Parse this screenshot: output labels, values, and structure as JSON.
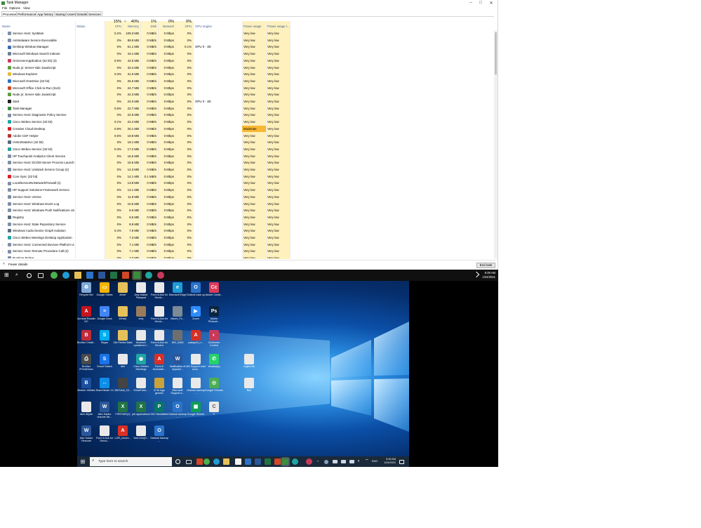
{
  "window": {
    "title": "Task Manager",
    "controls": [
      "–",
      "□",
      "✕"
    ]
  },
  "menu": [
    "File",
    "Options",
    "View"
  ],
  "tabs": [
    "Processes",
    "Performance",
    "App history",
    "Startup",
    "Users",
    "Details",
    "Services"
  ],
  "header": {
    "name": "Name",
    "status": "Status",
    "cpu_pct": "15%",
    "cpu": "CPU",
    "mem_pct": "40%",
    "mem": "Memory",
    "disk_pct": "1%",
    "disk": "Disk",
    "net_pct": "0%",
    "net": "Network",
    "gpu_pct": "0%",
    "gpu": "GPU",
    "gpu_engine": "GPU engine",
    "power": "Power usage",
    "power_trend": "Power usage t...",
    "sort_arrow": "˅"
  },
  "processes": [
    {
      "name": "Service Host: SysMain",
      "cpu": "0.2%",
      "mem": "109.3 MB",
      "disk": "0 MB/s",
      "net": "0 Mbps",
      "gpu": "0%",
      "engine": "",
      "power": "Very low",
      "trend": "Very low",
      "icon": "gear-icon",
      "color": "#7f8fa6",
      "exp": true
    },
    {
      "name": "Antimalware Service Executable",
      "cpu": "0%",
      "mem": "89.8 MB",
      "disk": "0 MB/s",
      "net": "0 Mbps",
      "gpu": "0%",
      "engine": "",
      "power": "Very low",
      "trend": "Very low",
      "icon": "gear-icon",
      "color": "#7f8fa6",
      "exp": true
    },
    {
      "name": "Desktop Window Manager",
      "cpu": "0%",
      "mem": "61.1 MB",
      "disk": "0 MB/s",
      "net": "0 Mbps",
      "gpu": "0.1%",
      "engine": "GPU 0 - 3D",
      "power": "Very low",
      "trend": "Very low",
      "icon": "window-icon",
      "color": "#3b6fb6",
      "exp": false
    },
    {
      "name": "Microsoft Windows Search Indexer",
      "cpu": "0%",
      "mem": "43.1 MB",
      "disk": "0 MB/s",
      "net": "0 Mbps",
      "gpu": "0%",
      "engine": "",
      "power": "Very low",
      "trend": "Very low",
      "icon": "search-icon",
      "color": "#6d7f95",
      "exp": true
    },
    {
      "name": "OnScreenApplication (32 bit) (3)",
      "cpu": "0.9%",
      "mem": "42.5 MB",
      "disk": "0 MB/s",
      "net": "0 Mbps",
      "gpu": "0%",
      "engine": "",
      "power": "Very low",
      "trend": "Very low",
      "icon": "onscreen-icon",
      "color": "#c93a5a",
      "exp": true
    },
    {
      "name": "Node.js: Server-side JavaScript",
      "cpu": "0%",
      "mem": "33.4 MB",
      "disk": "0 MB/s",
      "net": "0 Mbps",
      "gpu": "0%",
      "engine": "",
      "power": "Very low",
      "trend": "Very low",
      "icon": "nodejs-icon",
      "color": "#5f9e3a",
      "exp": false
    },
    {
      "name": "Windows Explorer",
      "cpu": "0.3%",
      "mem": "31.5 MB",
      "disk": "0 MB/s",
      "net": "0 Mbps",
      "gpu": "0%",
      "engine": "",
      "power": "Very low",
      "trend": "Very low",
      "icon": "folder-icon",
      "color": "#e6b93c",
      "exp": false
    },
    {
      "name": "Microsoft OneDrive (32 bit)",
      "cpu": "0%",
      "mem": "26.6 MB",
      "disk": "0 MB/s",
      "net": "0 Mbps",
      "gpu": "0%",
      "engine": "",
      "power": "Very low",
      "trend": "Very low",
      "icon": "cloud-icon",
      "color": "#2a73c9",
      "exp": false
    },
    {
      "name": "Microsoft Office Click-to-Run (SxS)",
      "cpu": "0%",
      "mem": "24.7 MB",
      "disk": "0 MB/s",
      "net": "0 Mbps",
      "gpu": "0%",
      "engine": "",
      "power": "Very low",
      "trend": "Very low",
      "icon": "office-icon",
      "color": "#d24726",
      "exp": true
    },
    {
      "name": "Node.js: Server-side JavaScript",
      "cpu": "0%",
      "mem": "24.3 MB",
      "disk": "0 MB/s",
      "net": "0 Mbps",
      "gpu": "0%",
      "engine": "",
      "power": "Very low",
      "trend": "Very low",
      "icon": "nodejs-icon",
      "color": "#5f9e3a",
      "exp": false
    },
    {
      "name": "Start",
      "cpu": "0%",
      "mem": "24.0 MB",
      "disk": "0 MB/s",
      "net": "0 Mbps",
      "gpu": "0%",
      "engine": "GPU 0 - 3D",
      "power": "Very low",
      "trend": "Very low",
      "icon": "start-icon",
      "color": "#222222",
      "exp": true
    },
    {
      "name": "Task Manager",
      "cpu": "0.6%",
      "mem": "22.7 MB",
      "disk": "0 MB/s",
      "net": "0 Mbps",
      "gpu": "0%",
      "engine": "",
      "power": "Very low",
      "trend": "Very low",
      "icon": "task-manager-icon",
      "color": "#3a8d3a",
      "exp": true
    },
    {
      "name": "Service Host: Diagnostic Policy Service",
      "cpu": "0%",
      "mem": "22.5 MB",
      "disk": "0 MB/s",
      "net": "0 Mbps",
      "gpu": "0%",
      "engine": "",
      "power": "Very low",
      "trend": "Very low",
      "icon": "gear-icon",
      "color": "#7f8fa6",
      "exp": true
    },
    {
      "name": "Cisco Webex Service (32 bit)",
      "cpu": "0.1%",
      "mem": "22.4 MB",
      "disk": "0 MB/s",
      "net": "0 Mbps",
      "gpu": "0%",
      "engine": "",
      "power": "Very low",
      "trend": "Very low",
      "icon": "webex-icon",
      "color": "#21a5a0",
      "exp": true
    },
    {
      "name": "Creative Cloud Desktop",
      "cpu": "0.8%",
      "mem": "20.1 MB",
      "disk": "0 MB/s",
      "net": "0 Mbps",
      "gpu": "0%",
      "engine": "",
      "power": "Moderate",
      "trend": "Very low",
      "icon": "creative-cloud-icon",
      "color": "#da1f26",
      "exp": true
    },
    {
      "name": "Adobe CEF Helper",
      "cpu": "0.6%",
      "mem": "19.8 MB",
      "disk": "0 MB/s",
      "net": "0 Mbps",
      "gpu": "0%",
      "engine": "",
      "power": "Very low",
      "trend": "Very low",
      "icon": "adobe-icon",
      "color": "#b8322e",
      "exp": false
    },
    {
      "name": "IAStorDataSvc (32 bit)",
      "cpu": "0%",
      "mem": "19.1 MB",
      "disk": "0 MB/s",
      "net": "0 Mbps",
      "gpu": "0%",
      "engine": "",
      "power": "Very low",
      "trend": "Very low",
      "icon": "storage-icon",
      "color": "#5a6b80",
      "exp": true
    },
    {
      "name": "Cisco Webex Service (32 bit)",
      "cpu": "0.3%",
      "mem": "17.2 MB",
      "disk": "0 MB/s",
      "net": "0 Mbps",
      "gpu": "0%",
      "engine": "",
      "power": "Very low",
      "trend": "Very low",
      "icon": "webex-icon",
      "color": "#21a5a0",
      "exp": true
    },
    {
      "name": "HP Touchpoint Analytics Client Service",
      "cpu": "0%",
      "mem": "16.6 MB",
      "disk": "0 MB/s",
      "net": "0 Mbps",
      "gpu": "0%",
      "engine": "",
      "power": "Very low",
      "trend": "Very low",
      "icon": "gear-icon",
      "color": "#7f8fa6",
      "exp": true
    },
    {
      "name": "Service Host: DCOM Server Process Launcher (5)",
      "cpu": "0%",
      "mem": "15.6 MB",
      "disk": "0 MB/s",
      "net": "0 Mbps",
      "gpu": "0%",
      "engine": "",
      "power": "Very low",
      "trend": "Very low",
      "icon": "gear-icon",
      "color": "#7f8fa6",
      "exp": true
    },
    {
      "name": "Service Host: Unistack Service Group (4)",
      "cpu": "0%",
      "mem": "14.3 MB",
      "disk": "0 MB/s",
      "net": "0 Mbps",
      "gpu": "0%",
      "engine": "",
      "power": "Very low",
      "trend": "Very low",
      "icon": "gear-icon",
      "color": "#7f8fa6",
      "exp": true
    },
    {
      "name": "Core Sync (32 bit)",
      "cpu": "0%",
      "mem": "14.1 MB",
      "disk": "0.1 MB/s",
      "net": "0 Mbps",
      "gpu": "0%",
      "engine": "",
      "power": "Very low",
      "trend": "Very low",
      "icon": "sync-icon",
      "color": "#da1f26",
      "exp": false
    },
    {
      "name": "LocalServiceNoNetworkFirewall (2)",
      "cpu": "0%",
      "mem": "13.8 MB",
      "disk": "0 MB/s",
      "net": "0 Mbps",
      "gpu": "0%",
      "engine": "",
      "power": "Very low",
      "trend": "Very low",
      "icon": "gear-icon",
      "color": "#7f8fa6",
      "exp": true
    },
    {
      "name": "HP Support Solutions Framework Service",
      "cpu": "0%",
      "mem": "13.1 MB",
      "disk": "0 MB/s",
      "net": "0 Mbps",
      "gpu": "0%",
      "engine": "",
      "power": "Very low",
      "trend": "Very low",
      "icon": "gear-icon",
      "color": "#7f8fa6",
      "exp": true
    },
    {
      "name": "Service Host: UtcSvc",
      "cpu": "0%",
      "mem": "11.9 MB",
      "disk": "0 MB/s",
      "net": "0 Mbps",
      "gpu": "0%",
      "engine": "",
      "power": "Very low",
      "trend": "Very low",
      "icon": "gear-icon",
      "color": "#7f8fa6",
      "exp": true
    },
    {
      "name": "Service Host: Windows Event Log",
      "cpu": "0%",
      "mem": "10.6 MB",
      "disk": "0 MB/s",
      "net": "0 Mbps",
      "gpu": "0%",
      "engine": "",
      "power": "Very low",
      "trend": "Very low",
      "icon": "gear-icon",
      "color": "#7f8fa6",
      "exp": true
    },
    {
      "name": "Service Host: Windows Push Notifications Use...",
      "cpu": "0%",
      "mem": "9.6 MB",
      "disk": "0 MB/s",
      "net": "0 Mbps",
      "gpu": "0%",
      "engine": "",
      "power": "Very low",
      "trend": "Very low",
      "icon": "gear-icon",
      "color": "#7f8fa6",
      "exp": true
    },
    {
      "name": "Registry",
      "cpu": "0%",
      "mem": "9.5 MB",
      "disk": "0 MB/s",
      "net": "0 Mbps",
      "gpu": "0%",
      "engine": "",
      "power": "Very low",
      "trend": "Very low",
      "icon": "registry-icon",
      "color": "#5a6b80",
      "exp": false
    },
    {
      "name": "Service Host: State Repository Service",
      "cpu": "0%",
      "mem": "8.8 MB",
      "disk": "0 MB/s",
      "net": "0 Mbps",
      "gpu": "0%",
      "engine": "",
      "power": "Very low",
      "trend": "Very low",
      "icon": "gear-icon",
      "color": "#7f8fa6",
      "exp": true
    },
    {
      "name": "Windows Audio Device Graph Isolation",
      "cpu": "0.4%",
      "mem": "7.9 MB",
      "disk": "0 MB/s",
      "net": "0 Mbps",
      "gpu": "0%",
      "engine": "",
      "power": "Very low",
      "trend": "Very low",
      "icon": "audio-icon",
      "color": "#5a6b80",
      "exp": false
    },
    {
      "name": "Cisco Webex Meetings Desktop Application",
      "cpu": "0%",
      "mem": "7.3 MB",
      "disk": "0 MB/s",
      "net": "0 Mbps",
      "gpu": "0%",
      "engine": "",
      "power": "Very low",
      "trend": "Very low",
      "icon": "webex-icon",
      "color": "#21a5a0",
      "exp": false
    },
    {
      "name": "Service Host: Connected Devices Platform Use...",
      "cpu": "0%",
      "mem": "7.1 MB",
      "disk": "0 MB/s",
      "net": "0 Mbps",
      "gpu": "0%",
      "engine": "",
      "power": "Very low",
      "trend": "Very low",
      "icon": "gear-icon",
      "color": "#7f8fa6",
      "exp": true
    },
    {
      "name": "Service Host: Remote Procedure Call (2)",
      "cpu": "0%",
      "mem": "7.1 MB",
      "disk": "0 MB/s",
      "net": "0 Mbps",
      "gpu": "0%",
      "engine": "",
      "power": "Very low",
      "trend": "Very low",
      "icon": "gear-icon",
      "color": "#7f8fa6",
      "exp": true
    },
    {
      "name": "Runtime Broker",
      "cpu": "0%",
      "mem": "7.0 MB",
      "disk": "0 MB/s",
      "net": "0 Mbps",
      "gpu": "0%",
      "engine": "",
      "power": "Very low",
      "trend": "Very low",
      "icon": "gear-icon",
      "color": "#7f8fa6",
      "exp": false
    }
  ],
  "footer": {
    "fewer_details": "Fewer details",
    "end_task": "End task"
  },
  "taskbar_outer": {
    "time": "9:39 AM",
    "date": "1/24/2021"
  },
  "desktop_icons": [
    {
      "label": "Recycle Bin",
      "icon": "recycle-bin-icon",
      "color": "#7fa9d6",
      "glyph": "♻"
    },
    {
      "label": "Google Slides",
      "icon": "google-slides-icon",
      "color": "#f4b400",
      "glyph": "▭"
    },
    {
      "label": "driver",
      "icon": "folder-icon",
      "color": "#e6c15a",
      "glyph": ""
    },
    {
      "label": "Amy Kaidor Passport",
      "icon": "document-icon",
      "color": "#e9e9e9",
      "glyph": ""
    },
    {
      "label": "Form 6 Ack for Servic...",
      "icon": "document-icon",
      "color": "#e9e9e9",
      "glyph": ""
    },
    {
      "label": "Microsoft Edge",
      "icon": "edge-icon",
      "color": "#1f9bd6",
      "glyph": "e"
    },
    {
      "label": "Outlook back up",
      "icon": "outlook-icon",
      "color": "#2a73c9",
      "glyph": "O"
    },
    {
      "label": "Adobe Creati...",
      "icon": "creative-cloud-icon",
      "color": "#e03a5a",
      "glyph": "Cc"
    },
    {
      "label": "Acrobat Reader DC",
      "icon": "acrobat-icon",
      "color": "#c4161c",
      "glyph": "A"
    },
    {
      "label": "Google Docs",
      "icon": "google-docs-icon",
      "color": "#4285f4",
      "glyph": "≡"
    },
    {
      "label": "inthelp",
      "icon": "folder-icon",
      "color": "#e6c15a",
      "glyph": ""
    },
    {
      "label": "amy",
      "icon": "photo-icon",
      "color": "#9a7c5a",
      "glyph": ""
    },
    {
      "label": "Form 6 Ack for Servic...",
      "icon": "document-icon",
      "color": "#e9e9e9",
      "glyph": ""
    },
    {
      "label": "Machi_Pc...",
      "icon": "photo-icon",
      "color": "#7c8a96",
      "glyph": ""
    },
    {
      "label": "Zoom",
      "icon": "zoom-icon",
      "color": "#2d8cff",
      "glyph": "▶"
    },
    {
      "label": "Adobe Photosh...",
      "icon": "photoshop-icon",
      "color": "#0b2540",
      "glyph": "Ps"
    },
    {
      "label": "Brother Creati...",
      "icon": "brother-icon",
      "color": "#c22b3a",
      "glyph": "B"
    },
    {
      "label": "Skype",
      "icon": "skype-icon",
      "color": "#00aff0",
      "glyph": "S"
    },
    {
      "label": "Old Firefox Data",
      "icon": "folder-icon",
      "color": "#e6c15a",
      "glyph": ""
    },
    {
      "label": "biomech questions f...",
      "icon": "document-icon",
      "color": "#e9e9e9",
      "glyph": ""
    },
    {
      "label": "Form 6 Ack for Service",
      "icon": "document-icon",
      "color": "#e9e9e9",
      "glyph": ""
    },
    {
      "label": "IMV_0408",
      "icon": "photo-icon",
      "color": "#6f6f6f",
      "glyph": ""
    },
    {
      "label": "passport_n...",
      "icon": "pdf-icon",
      "color": "#d93025",
      "glyph": "A"
    },
    {
      "label": "OnScreen Control",
      "icon": "onscreen-icon",
      "color": "#c93a5a",
      "glyph": "◐"
    },
    {
      "label": "Brother iPrint&Scan",
      "icon": "printer-icon",
      "color": "#4a4a4a",
      "glyph": "⎙"
    },
    {
      "label": "Smart Switch",
      "icon": "smart-switch-icon",
      "color": "#1a73e8",
      "glyph": "S"
    },
    {
      "label": "dee",
      "icon": "document-icon",
      "color": "#e9e9e9",
      "glyph": ""
    },
    {
      "label": "Cisco Webex Meetings",
      "icon": "webex-icon",
      "color": "#21a5a0",
      "glyph": "◉"
    },
    {
      "label": "Form 6 Acknowle...",
      "icon": "pdf-icon",
      "color": "#d93025",
      "glyph": "A"
    },
    {
      "label": "Notification of Appoint...",
      "icon": "word-icon",
      "color": "#2b579a",
      "glyph": "W"
    },
    {
      "label": "MS Support chat conv...",
      "icon": "document-icon",
      "color": "#e9e9e9",
      "glyph": ""
    },
    {
      "label": "WhatsApp",
      "icon": "whatsapp-icon",
      "color": "#25d366",
      "glyph": "✆"
    },
    {
      "label": "Brother Utilities",
      "icon": "brother-icon",
      "color": "#1b4fa0",
      "glyph": "B"
    },
    {
      "label": "TeamViewer 14",
      "icon": "teamviewer-icon",
      "color": "#0e8ee9",
      "glyph": "↔"
    },
    {
      "label": "2667ddd_15...",
      "icon": "photo-icon",
      "color": "#444444",
      "glyph": ""
    },
    {
      "label": "EmailTicke...",
      "icon": "document-icon",
      "color": "#e9e9e9",
      "glyph": ""
    },
    {
      "label": "IO fb logo generic",
      "icon": "photo-icon",
      "color": "#c8a23a",
      "glyph": ""
    },
    {
      "label": "Microsoft Support a...",
      "icon": "document-icon",
      "color": "#e9e9e9",
      "glyph": ""
    },
    {
      "label": "Outlook backup ...",
      "icon": "document-icon",
      "color": "#e9e9e9",
      "glyph": ""
    },
    {
      "label": "Google Chrome",
      "icon": "chrome-icon",
      "color": "#4caf50",
      "glyph": "◎"
    },
    {
      "label": "Alex Aliyah",
      "icon": "document-icon",
      "color": "#e9e9e9",
      "glyph": ""
    },
    {
      "label": "Alex Kaidor resume Ne...",
      "icon": "word-icon",
      "color": "#2b579a",
      "glyph": "W"
    },
    {
      "label": "FIRSTAID(1)",
      "icon": "excel-icon",
      "color": "#217346",
      "glyph": "X"
    },
    {
      "label": "job applications",
      "icon": "excel-icon",
      "color": "#217346",
      "glyph": "X"
    },
    {
      "label": "TAC Newsletter",
      "icon": "publisher-icon",
      "color": "#077568",
      "glyph": "P"
    },
    {
      "label": "Outlook backup ...",
      "icon": "outlook-icon",
      "color": "#2a73c9",
      "glyph": "O"
    },
    {
      "label": "Google Sheets",
      "icon": "google-sheets-icon",
      "color": "#0f9d58",
      "glyph": "▦"
    },
    {
      "label": "C",
      "icon": "document-icon",
      "color": "#e9e9e9",
      "glyph": "C"
    },
    {
      "label": "Alex Kaidor Resume",
      "icon": "word-icon",
      "color": "#2b579a",
      "glyph": "W"
    },
    {
      "label": "Form 6 Ack for Servic...",
      "icon": "document-icon",
      "color": "#e9e9e9",
      "glyph": ""
    },
    {
      "label": "LOR_recom...",
      "icon": "pdf-icon",
      "color": "#d93025",
      "glyph": "A"
    },
    {
      "label": "York-Kim(O...",
      "icon": "document-icon",
      "color": "#e9e9e9",
      "glyph": ""
    },
    {
      "label": "Outlook backup ...",
      "icon": "outlook-icon",
      "color": "#2a73c9",
      "glyph": "O"
    },
    {
      "label": "reglist.lnk",
      "icon": "document-icon",
      "color": "#e9e9e9",
      "glyph": ""
    },
    {
      "label": "Bob",
      "icon": "document-icon",
      "color": "#e9e9e9",
      "glyph": ""
    }
  ],
  "taskbar_inner": {
    "search_placeholder": "Type here to search",
    "lang": "ENG",
    "time": "9:39 AM",
    "date": "1/24/2021"
  },
  "colors": {
    "cpu_band": "#fff4c4",
    "power_band": "#fff1bd",
    "moderate": "#f7b733"
  }
}
